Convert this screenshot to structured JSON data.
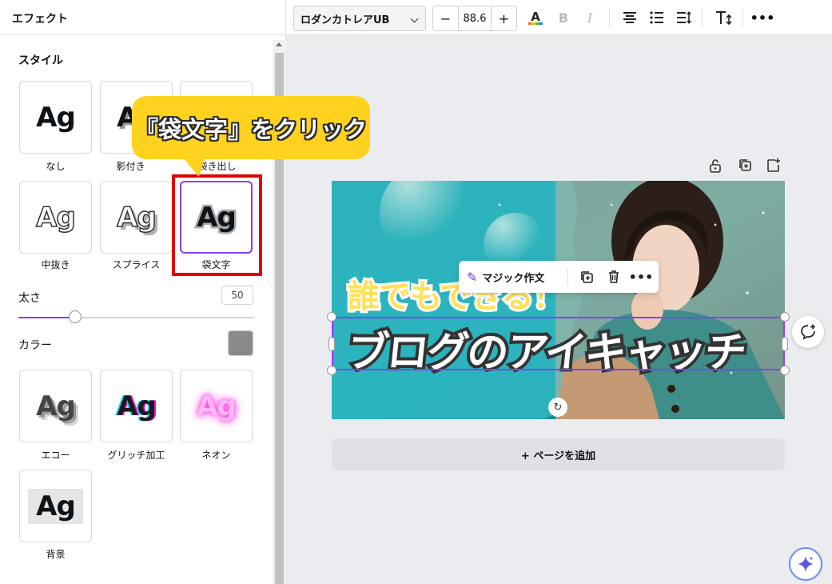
{
  "panel": {
    "title": "エフェクト",
    "section_title": "スタイル",
    "styles": [
      {
        "label": "なし",
        "preview": "Ag"
      },
      {
        "label": "影付き",
        "preview": "Ag"
      },
      {
        "label": "袋き出し",
        "preview": "Ag"
      },
      {
        "label": "中抜き",
        "preview": "Ag"
      },
      {
        "label": "スプライス",
        "preview": "Ag"
      },
      {
        "label": "袋文字",
        "preview": "Ag"
      },
      {
        "label": "エコー",
        "preview": "Ag"
      },
      {
        "label": "グリッチ加工",
        "preview": "Ag"
      },
      {
        "label": "ネオン",
        "preview": "Ag"
      },
      {
        "label": "背景",
        "preview": "Ag"
      }
    ],
    "selected_style": "袋文字",
    "weight_label": "太さ",
    "weight_value": "50",
    "weight_fraction": 0.24,
    "color_label": "カラー",
    "color_value": "#8a8a8a",
    "accent_color": "#8b3dff"
  },
  "callout": {
    "text": "『袋文字』をクリック",
    "color": "#ffd21f"
  },
  "toolbar": {
    "font_name": "ロダンカトレアUB",
    "minus": "−",
    "font_size": "88.6",
    "plus": "+",
    "icons": [
      "text-color-icon",
      "bold-icon",
      "italic-icon",
      "align-center-icon",
      "list-icon",
      "line-spacing-icon",
      "text-transform-icon",
      "more-icon"
    ]
  },
  "canvas": {
    "headline_top": "誰でもできる！",
    "headline_main": "ブログのアイキャッチ",
    "magic_write": "マジック作文",
    "add_page": "+ ページを追加"
  }
}
